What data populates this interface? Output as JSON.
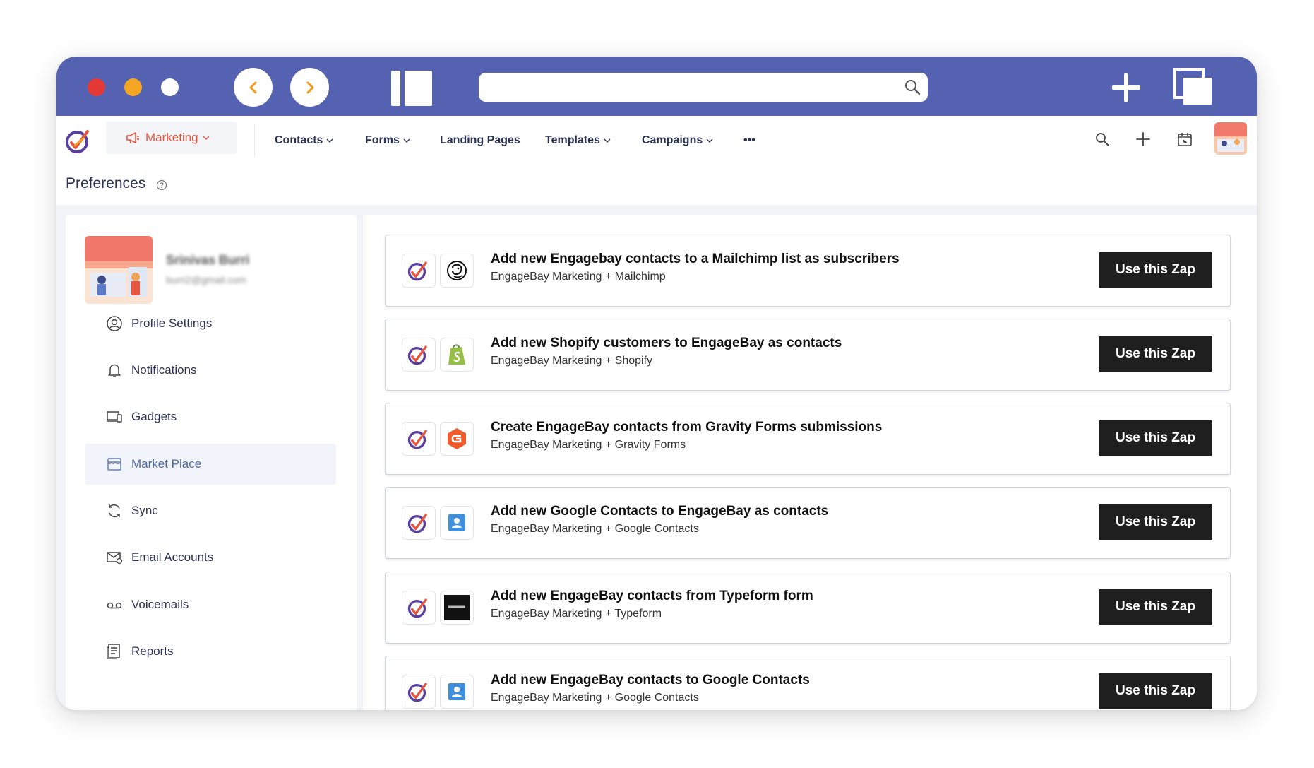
{
  "browser": {
    "controls": [
      "close",
      "minimize",
      "zoom"
    ],
    "url": ""
  },
  "header": {
    "module_label": "Marketing",
    "menu": [
      {
        "label": "Contacts",
        "has_dropdown": true
      },
      {
        "label": "Forms",
        "has_dropdown": true
      },
      {
        "label": "Landing Pages",
        "has_dropdown": false
      },
      {
        "label": "Templates",
        "has_dropdown": true
      },
      {
        "label": "Campaigns",
        "has_dropdown": true
      }
    ],
    "more_label": "•••"
  },
  "page": {
    "title": "Preferences"
  },
  "profile": {
    "name": "Srinivas Burri",
    "email": "burri2@gmail.com"
  },
  "sidebar": {
    "items": [
      {
        "label": "Profile Settings",
        "icon": "user-circle-icon",
        "active": false
      },
      {
        "label": "Notifications",
        "icon": "bell-icon",
        "active": false
      },
      {
        "label": "Gadgets",
        "icon": "devices-icon",
        "active": false
      },
      {
        "label": "Market Place",
        "icon": "store-icon",
        "active": true
      },
      {
        "label": "Sync",
        "icon": "sync-icon",
        "active": false
      },
      {
        "label": "Email Accounts",
        "icon": "email-accounts-icon",
        "active": false
      },
      {
        "label": "Voicemails",
        "icon": "voicemail-icon",
        "active": false
      },
      {
        "label": "Reports",
        "icon": "report-icon",
        "active": false
      }
    ]
  },
  "zaps": [
    {
      "title": "Add new Engagebay contacts to a Mailchimp list as subscribers",
      "subtitle": "EngageBay Marketing + Mailchimp",
      "app_icon": "mailchimp-icon",
      "button": "Use this Zap"
    },
    {
      "title": "Add new Shopify customers to EngageBay as contacts",
      "subtitle": "EngageBay Marketing + Shopify",
      "app_icon": "shopify-icon",
      "button": "Use this Zap"
    },
    {
      "title": "Create EngageBay contacts from Gravity Forms submissions",
      "subtitle": "EngageBay Marketing + Gravity Forms",
      "app_icon": "gravity-forms-icon",
      "button": "Use this Zap"
    },
    {
      "title": "Add new Google Contacts to EngageBay as contacts",
      "subtitle": "EngageBay Marketing + Google Contacts",
      "app_icon": "google-contacts-icon",
      "button": "Use this Zap"
    },
    {
      "title": "Add new EngageBay contacts from Typeform form",
      "subtitle": "EngageBay Marketing + Typeform",
      "app_icon": "typeform-icon",
      "button": "Use this Zap"
    },
    {
      "title": "Add new EngageBay contacts to Google Contacts",
      "subtitle": "EngageBay Marketing + Google Contacts",
      "app_icon": "google-contacts-icon",
      "button": "Use this Zap"
    }
  ],
  "colors": {
    "titlebar": "#5462b1",
    "accent": "#e8553e",
    "button": "#1f1f1f",
    "active_item_bg": "#f1f4fa"
  }
}
